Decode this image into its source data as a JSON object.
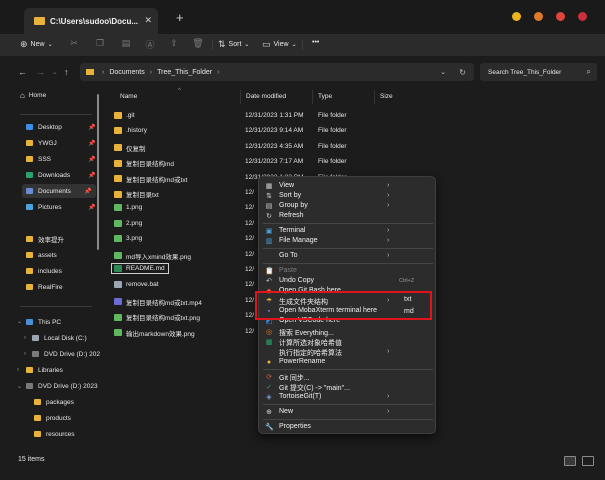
{
  "window": {
    "tab_title": "C:\\Users\\sudoo\\Docu...",
    "tab_close": "✕",
    "new_tab": "+"
  },
  "toolbar": {
    "new_label": "New",
    "sort_label": "Sort",
    "view_label": "View",
    "more_label": "•••"
  },
  "address": {
    "crumbs": [
      "Documents",
      "Tree_This_Folder"
    ],
    "search_placeholder": "Search Tree_This_Folder"
  },
  "sidebar": {
    "home": "Home",
    "quick": [
      "Desktop",
      "YWGJ",
      "SSS",
      "Downloads",
      "Documents",
      "Pictures",
      "效率提升",
      "assets",
      "includes",
      "RealFire"
    ],
    "this_pc": "This PC",
    "drives": [
      "Local Disk (C:)",
      "DVD Drive (D:) 202"
    ],
    "libraries": "Libraries",
    "dvd2": "DVD Drive (D:) 2023",
    "dvd_children": [
      "packages",
      "products",
      "resources"
    ]
  },
  "columns": {
    "name": "Name",
    "date": "Date modified",
    "type": "Type",
    "size": "Size"
  },
  "files": [
    {
      "name": ".git",
      "date": "12/31/2023 1:31 PM",
      "type": "File folder",
      "size": ""
    },
    {
      "name": ".history",
      "date": "12/31/2023 9:14 AM",
      "type": "File folder",
      "size": ""
    },
    {
      "name": "仅复制",
      "date": "12/31/2023 4:35 AM",
      "type": "File folder",
      "size": ""
    },
    {
      "name": "复制目录结构md",
      "date": "12/31/2023 7:17 AM",
      "type": "File folder",
      "size": ""
    },
    {
      "name": "复制目录结构md或txt",
      "date": "12/31/2023 1:22 PM",
      "type": "File folder",
      "size": ""
    },
    {
      "name": "复制目录txt",
      "date": "12/",
      "type": "",
      "size": ""
    },
    {
      "name": "1.png",
      "date": "12/",
      "type": "",
      "size": "31 KB"
    },
    {
      "name": "2.png",
      "date": "12/",
      "type": "",
      "size": "23 KB"
    },
    {
      "name": "3.png",
      "date": "12/",
      "type": "",
      "size": "33 KB"
    },
    {
      "name": "md导入xmind效果.png",
      "date": "12/",
      "type": "",
      "size": "76 KB"
    },
    {
      "name": "README.md",
      "date": "12/",
      "type": "",
      "size": "2 KB"
    },
    {
      "name": "remove.bat",
      "date": "12/",
      "type": "",
      "size": "1 KB"
    },
    {
      "name": "复制目录结构md或txt.mp4",
      "date": "12/",
      "type": "",
      "size": "06 KB"
    },
    {
      "name": "复制目录结构md或txt.png",
      "date": "12/",
      "type": "",
      "size": "68 KB"
    },
    {
      "name": "输出markdown效果.png",
      "date": "12/",
      "type": "",
      "size": "29 KB"
    }
  ],
  "status": {
    "count": "15 items"
  },
  "context_menu": {
    "items": [
      {
        "label": "View",
        "arrow": true
      },
      {
        "label": "Sort by",
        "arrow": true
      },
      {
        "label": "Group by",
        "arrow": true
      },
      {
        "label": "Refresh"
      },
      {
        "label": "Terminal",
        "arrow": true
      },
      {
        "label": "File Manage",
        "arrow": true
      },
      {
        "label": "Go To",
        "arrow": true
      },
      {
        "label": "Paste",
        "disabled": true
      },
      {
        "label": "Undo Copy",
        "shortcut": "Ctrl+Z"
      },
      {
        "label": "Open Git Bash here"
      },
      {
        "label": "生成文件夹结构",
        "arrow": true
      },
      {
        "label": "Open MobaXterm terminal here"
      },
      {
        "label": "Open VSCode here"
      },
      {
        "label": "搜索 Everything..."
      },
      {
        "label": "计算所选对象哈希值"
      },
      {
        "label": "执行指定的哈希算法",
        "arrow": true
      },
      {
        "label": "PowerRename"
      },
      {
        "label": "Git 同步..."
      },
      {
        "label": "Git 提交(C) -> \"main\"..."
      },
      {
        "label": "TortoiseGit(T)",
        "arrow": true
      },
      {
        "label": "New",
        "arrow": true
      },
      {
        "label": "Properties"
      }
    ],
    "submenu_txt": "txt",
    "submenu_md": "md"
  },
  "colors": {
    "folder": "#e8b33b",
    "highlight_border": "#e0151b"
  }
}
